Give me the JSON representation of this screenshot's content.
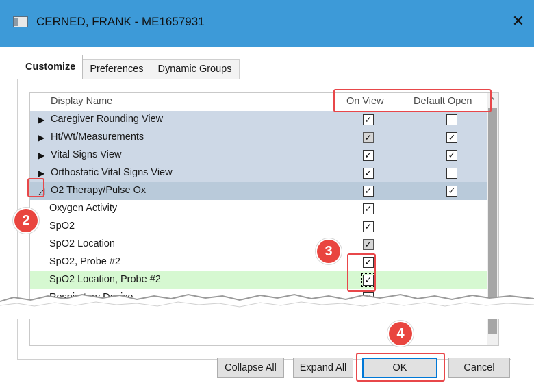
{
  "window": {
    "title": "CERNED, FRANK - ME1657931",
    "close_glyph": "✕",
    "title_icon": "window-app-icon"
  },
  "tabs": [
    {
      "label": "Customize",
      "active": true
    },
    {
      "label": "Preferences",
      "active": false
    },
    {
      "label": "Dynamic Groups",
      "active": false
    }
  ],
  "grid": {
    "columns": {
      "display_name": "Display Name",
      "on_view": "On View",
      "default_open": "Default Open"
    },
    "rows": [
      {
        "label": "Caregiver Rounding View",
        "type": "parent",
        "expanded": false,
        "on_view": "checked",
        "on_view_gray": false,
        "default_open": "unchecked"
      },
      {
        "label": "Ht/Wt/Measurements",
        "type": "parent",
        "expanded": false,
        "on_view": "checked",
        "on_view_gray": true,
        "default_open": "checked"
      },
      {
        "label": "Vital Signs View",
        "type": "parent",
        "expanded": false,
        "on_view": "checked",
        "on_view_gray": false,
        "default_open": "checked"
      },
      {
        "label": "Orthostatic Vital Signs View",
        "type": "parent",
        "expanded": false,
        "on_view": "checked",
        "on_view_gray": false,
        "default_open": "unchecked"
      },
      {
        "label": "O2 Therapy/Pulse Ox",
        "type": "parent",
        "expanded": true,
        "selected": true,
        "on_view": "checked",
        "on_view_gray": false,
        "default_open": "checked"
      },
      {
        "label": "Oxygen Activity",
        "type": "child",
        "on_view": "checked",
        "on_view_gray": false
      },
      {
        "label": "SpO2",
        "type": "child",
        "on_view": "checked",
        "on_view_gray": false
      },
      {
        "label": "SpO2 Location",
        "type": "child",
        "on_view": "checked",
        "on_view_gray": true
      },
      {
        "label": "SpO2, Probe #2",
        "type": "child",
        "on_view": "checked",
        "on_view_gray": false
      },
      {
        "label": "SpO2 Location, Probe #2",
        "type": "child",
        "highlight": true,
        "on_view": "checked",
        "on_view_gray": false
      },
      {
        "label": "Respiratory Device",
        "type": "child",
        "on_view": "checked",
        "on_view_gray": false
      }
    ],
    "check_glyph": "✓",
    "collapsed_glyph": "▶",
    "expanded_glyph": "◿",
    "scroll_up_glyph": "^"
  },
  "buttons": {
    "collapse_all": "Collapse All",
    "expand_all": "Expand All",
    "ok": "OK",
    "cancel": "Cancel"
  },
  "callouts": {
    "step2": "2",
    "step3": "3",
    "step4": "4",
    "color": "#e9453f"
  },
  "colors": {
    "titlebar": "#3d9ad8",
    "parent_row": "#cdd8e6",
    "selected_row": "#b9cada",
    "highlight_row": "#d6f8d1",
    "focus_button": "#0078d7"
  }
}
